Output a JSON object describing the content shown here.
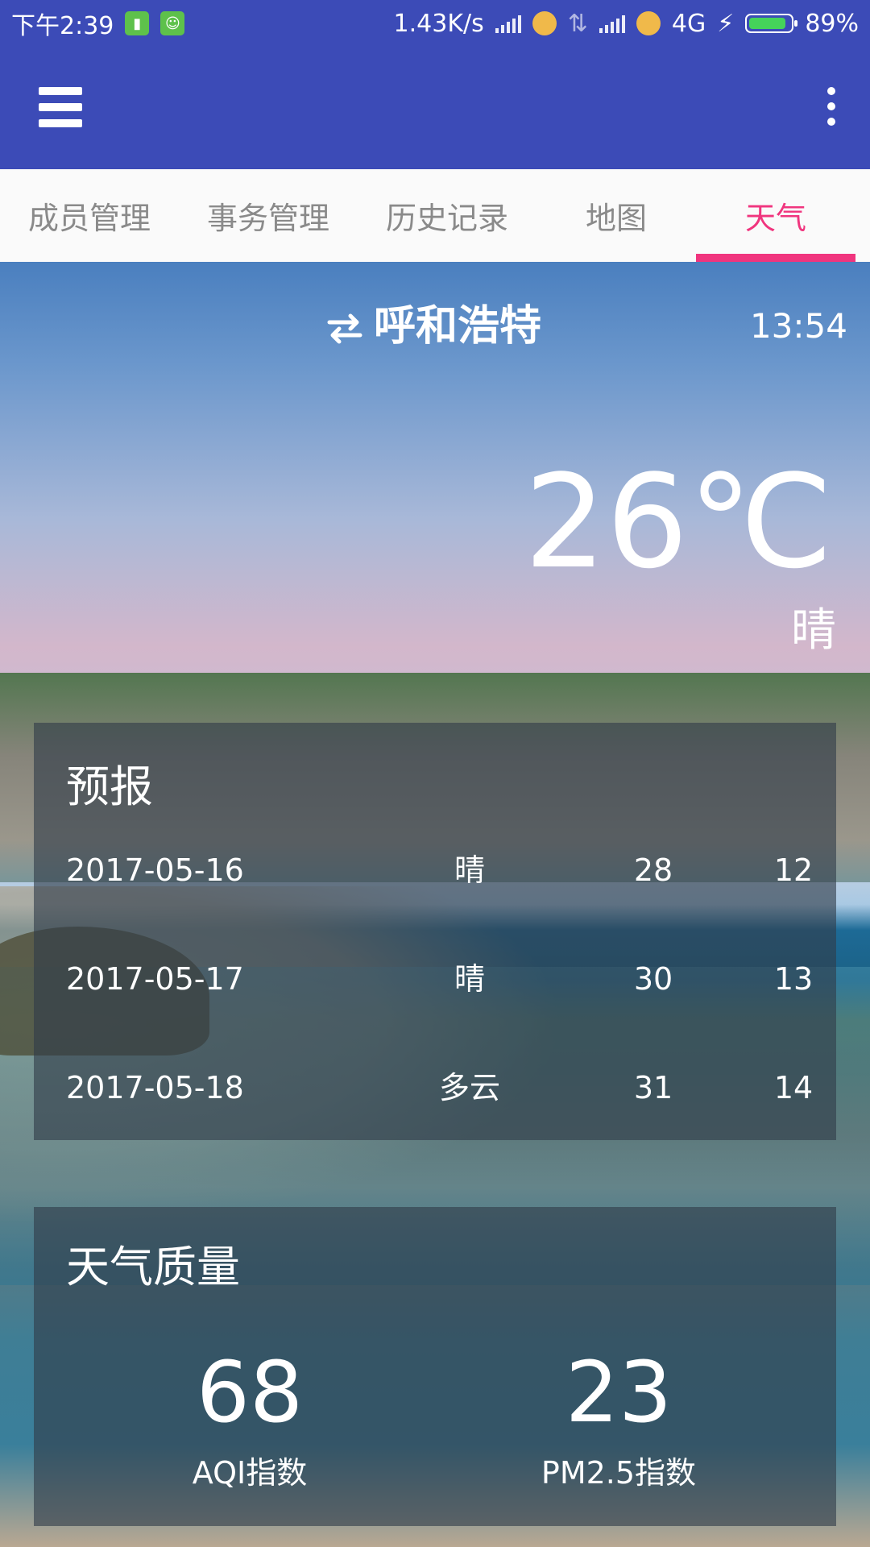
{
  "status_bar": {
    "time": "下午2:39",
    "network_speed": "1.43K/s",
    "network_type": "4G",
    "battery_percent": "89%",
    "battery_level": 0.89
  },
  "tabs": [
    {
      "label": "成员管理",
      "active": false
    },
    {
      "label": "事务管理",
      "active": false
    },
    {
      "label": "历史记录",
      "active": false
    },
    {
      "label": "地图",
      "active": false
    },
    {
      "label": "天气",
      "active": true
    }
  ],
  "weather": {
    "city": "呼和浩特",
    "update_time": "13:54",
    "temperature": "26℃",
    "condition": "晴"
  },
  "forecast": {
    "title": "预报",
    "rows": [
      {
        "date": "2017-05-16",
        "condition": "晴",
        "high": "28",
        "low": "12"
      },
      {
        "date": "2017-05-17",
        "condition": "晴",
        "high": "30",
        "low": "13"
      },
      {
        "date": "2017-05-18",
        "condition": "多云",
        "high": "31",
        "low": "14"
      }
    ]
  },
  "air_quality": {
    "title": "天气质量",
    "aqi_value": "68",
    "aqi_label": "AQI指数",
    "pm25_value": "23",
    "pm25_label": "PM2.5指数"
  },
  "colors": {
    "primary": "#3c4bb7",
    "accent": "#f0357e",
    "tab_inactive": "#8a8a8a"
  }
}
